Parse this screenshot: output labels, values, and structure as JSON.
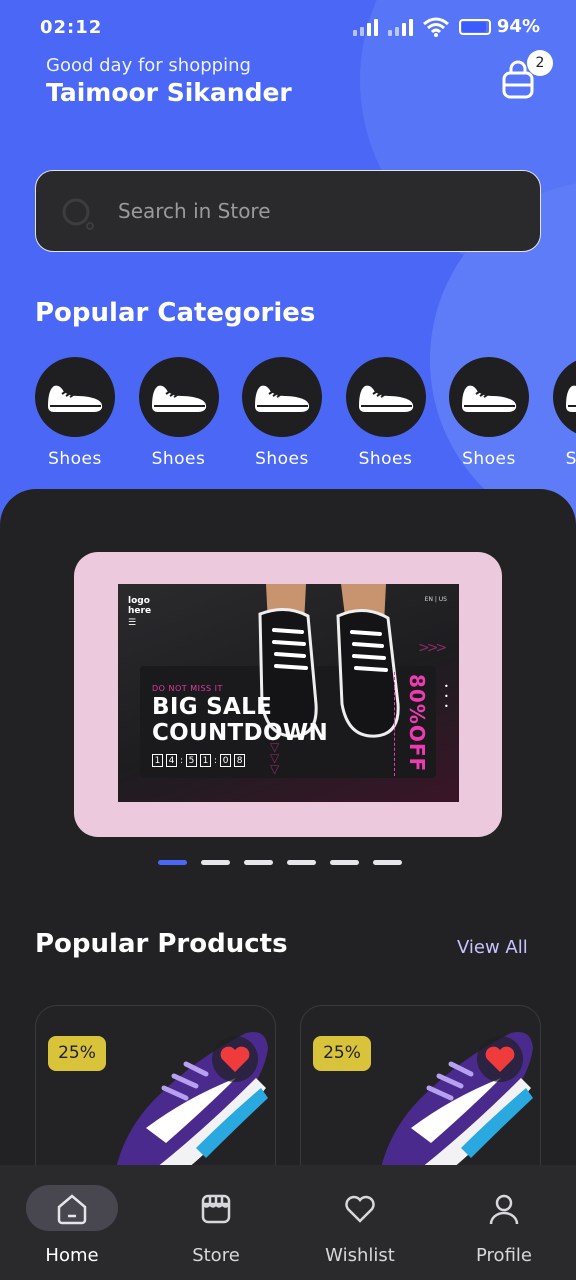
{
  "status": {
    "time": "02:12",
    "battery": "94%"
  },
  "header": {
    "greeting": "Good day for shopping",
    "user_name": "Taimoor Sikander",
    "cart_count": "2"
  },
  "search": {
    "placeholder": "Search in Store"
  },
  "categories": {
    "title": "Popular Categories",
    "items": [
      {
        "label": "Shoes"
      },
      {
        "label": "Shoes"
      },
      {
        "label": "Shoes"
      },
      {
        "label": "Shoes"
      },
      {
        "label": "Shoes"
      },
      {
        "label": "Shoes"
      }
    ]
  },
  "banner": {
    "logo": "logo\nhere",
    "corner": "EN | US",
    "tagline": "DO NOT MISS IT",
    "headline_1": "BIG SALE",
    "headline_2": "COUNTDOWN",
    "timer": [
      "1",
      "4",
      "5",
      "1",
      "0",
      "8"
    ],
    "offer": "80%OFF",
    "active_slide": 0,
    "slide_count": 6
  },
  "products": {
    "title": "Popular Products",
    "view_all": "View All",
    "items": [
      {
        "discount": "25%"
      },
      {
        "discount": "25%"
      }
    ]
  },
  "nav": {
    "items": [
      {
        "label": "Home",
        "icon": "home-icon",
        "active": true
      },
      {
        "label": "Store",
        "icon": "store-icon",
        "active": false
      },
      {
        "label": "Wishlist",
        "icon": "heart-icon",
        "active": false
      },
      {
        "label": "Profile",
        "icon": "user-icon",
        "active": false
      }
    ]
  },
  "colors": {
    "accent": "#4a68f5",
    "panel": "#222224",
    "banner_bg": "#ecc9dc",
    "badge": "#d9c33b",
    "heart": "#ef3b3b"
  }
}
